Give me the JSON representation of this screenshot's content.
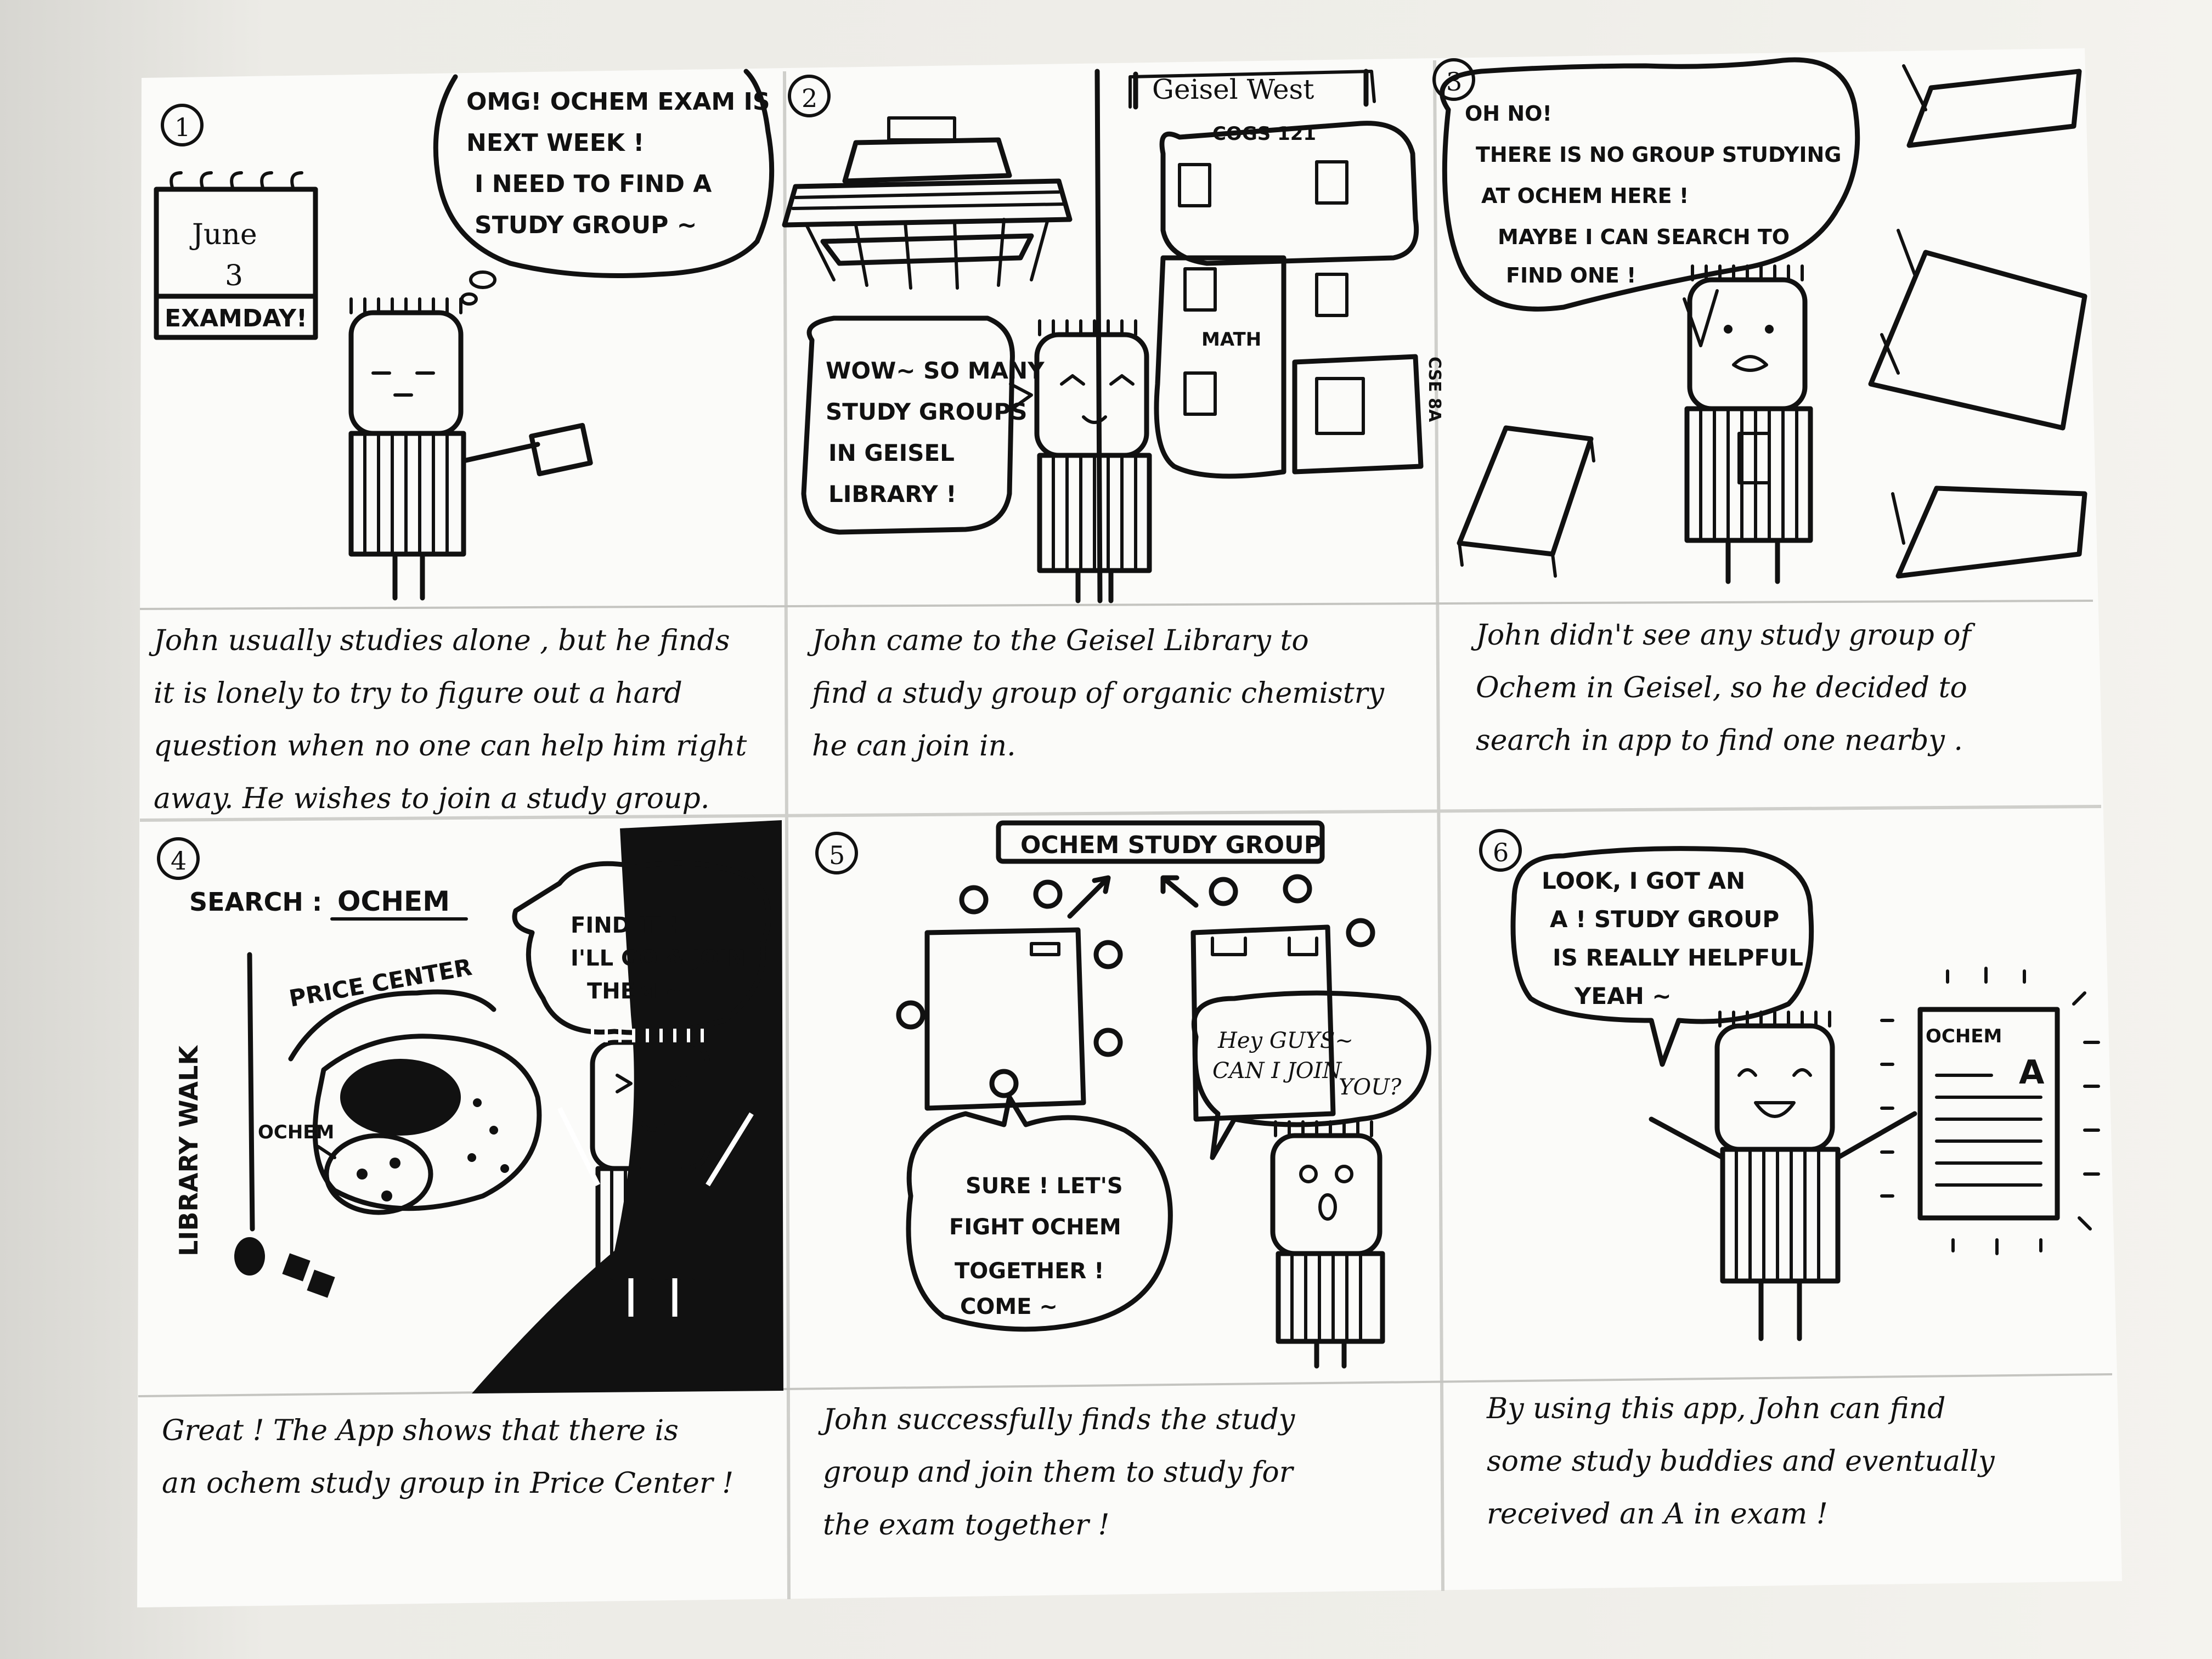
{
  "panels": [
    {
      "number": "1",
      "bubble": [
        "OMG! OCHEM EXAM IS",
        "NEXT WEEK !",
        "I NEED TO FIND A",
        "STUDY GROUP ~"
      ],
      "calendar_month": "June",
      "calendar_day": "3",
      "calendar_label": "EXAMDAY!",
      "caption": [
        "John  usually  studies alone ,  but  he  finds",
        "it  is  lonely  to  try  to  figure  out  a  hard",
        "question  when  no  one  can  help  him  right",
        "away.  He  wishes to  join  a  study  group."
      ]
    },
    {
      "number": "2",
      "bubble": [
        "WOW~ SO MANY",
        "STUDY GROUPS",
        "IN GEISEL",
        "LIBRARY !"
      ],
      "map_title": "Geisel  West",
      "map_labels": [
        "COGS 121",
        "MATH",
        "CSE 8A"
      ],
      "caption": [
        "John  came  to  the  Geisel  Library  to",
        "find  a  study  group  of  organic  chemistry",
        "he  can  join  in."
      ]
    },
    {
      "number": "3",
      "bubble": [
        "OH NO!",
        "THERE IS NO GROUP STUDYING",
        "AT OCHEM HERE !",
        "MAYBE I CAN SEARCH TO",
        "FIND ONE !"
      ],
      "caption": [
        "John  didn't  see  any  study  group  of",
        "Ochem  in  Geisel,  so  he  decided  to",
        "search  in  app  to  find  one  nearby ."
      ]
    },
    {
      "number": "4",
      "search_label": "SEARCH :",
      "search_term": "OCHEM",
      "map_labels": [
        "PRICE CENTER",
        "LIBRARY  WALK",
        "OCHEM"
      ],
      "bubble": [
        "FIND IT !",
        "I'LL GO & JOIN",
        "THEM ~"
      ],
      "caption": [
        "Great !  The  App  shows  that  there  is",
        "an  ochem  study  group  in  Price  Center !"
      ]
    },
    {
      "number": "5",
      "sign": "OCHEM STUDY GROUP",
      "bubble_left": [
        "SURE ! LET'S",
        "FIGHT  OCHEM",
        "TOGETHER !",
        "COME ~"
      ],
      "bubble_right": [
        "Hey GUYS~",
        "CAN I JOIN",
        "YOU?"
      ],
      "caption": [
        "John  successfully  finds  the  study",
        "group  and  join  them  to  study  for",
        "the  exam  together !"
      ]
    },
    {
      "number": "6",
      "bubble": [
        "LOOK, I GOT AN",
        "A !  STUDY GROUP",
        "IS REALLY HELPFUL",
        "YEAH ~"
      ],
      "paper_title": "OCHEM",
      "paper_grade": "A",
      "caption": [
        "By  using  this  app,  John  can  find",
        "some  study  buddies  and  eventually",
        "received  an  A  in  exam  !"
      ]
    }
  ]
}
